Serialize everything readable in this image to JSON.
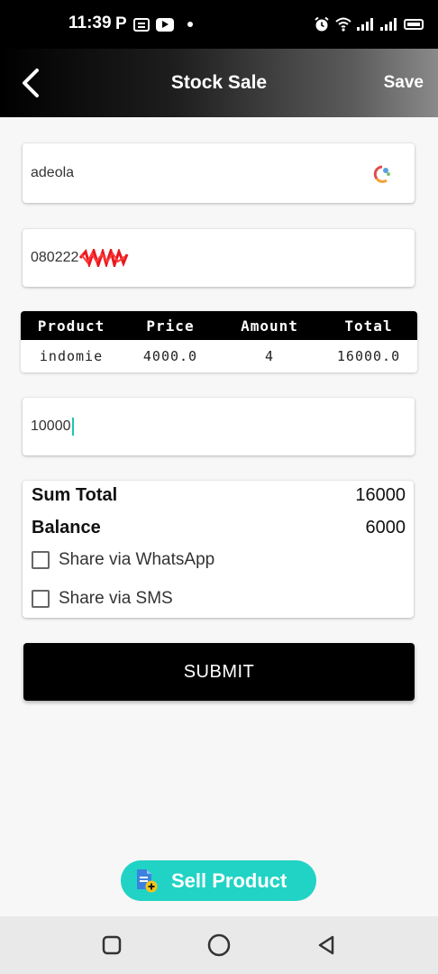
{
  "status_bar": {
    "time": "11:39",
    "left_icons": [
      "p-icon",
      "message-icon",
      "youtube-icon",
      "dot-icon"
    ],
    "right_icons": [
      "alarm-icon",
      "wifi-icon",
      "signal-icon",
      "signal-icon",
      "battery-icon"
    ]
  },
  "app_bar": {
    "title": "Stock Sale",
    "save_label": "Save",
    "back_icon": "chevron-left-icon"
  },
  "form": {
    "customer_name": "adeola",
    "phone_visible": "080222",
    "amount_paid": "10000"
  },
  "product_table": {
    "columns": [
      "Product",
      "Price",
      "Amount",
      "Total"
    ],
    "rows": [
      {
        "product": "indomie",
        "price": "4000.0",
        "amount": "4",
        "total": "16000.0"
      }
    ]
  },
  "summary": {
    "sum_total_label": "Sum Total",
    "sum_total_value": "16000",
    "balance_label": "Balance",
    "balance_value": "6000",
    "share_whatsapp": "Share via WhatsApp",
    "share_sms": "Share via SMS"
  },
  "submit_label": "SUBMIT",
  "sell_product_label": "Sell Product",
  "colors": {
    "accent": "#21d3c5",
    "primary": "#000000"
  }
}
